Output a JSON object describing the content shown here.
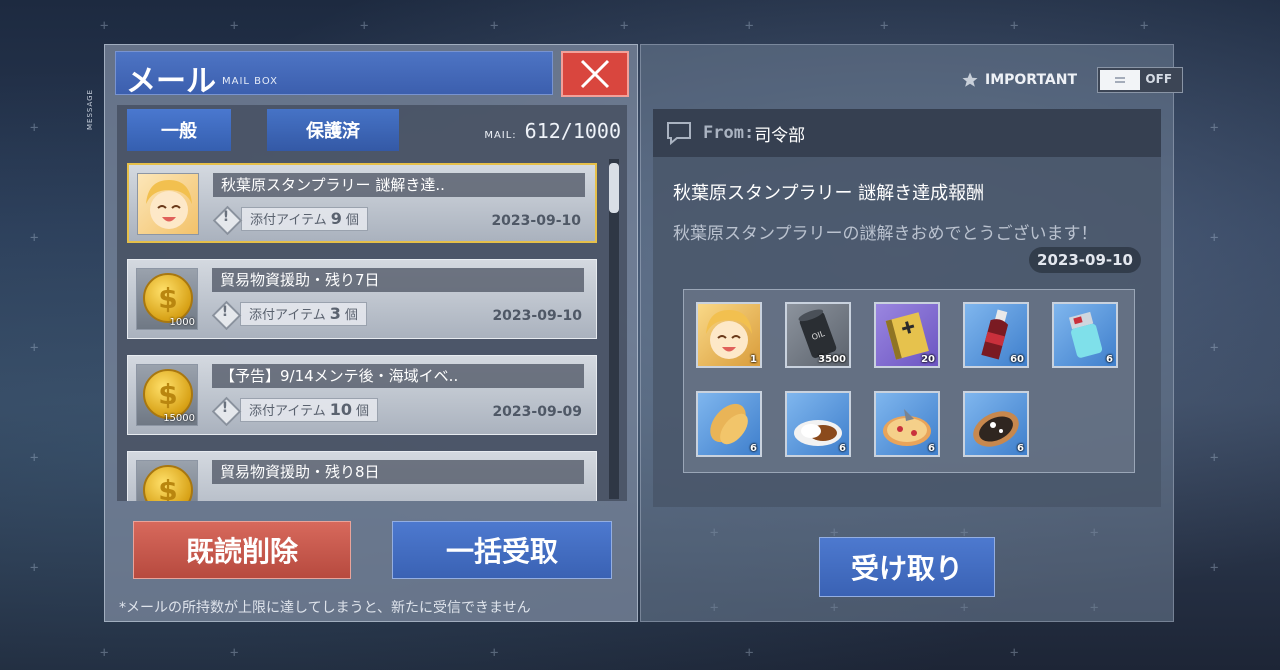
{
  "side_tag": "MESSAGE",
  "mailbox": {
    "title": "メール",
    "subtitle": "MAIL BOX",
    "tabs": [
      {
        "label": "一般"
      },
      {
        "label": "保護済"
      }
    ],
    "mail_count_label": "MAIL:",
    "mail_count": "612/1000",
    "mails": [
      {
        "title": "秋葉原スタンプラリー 謎解き達..",
        "attach_label": "添付アイテム",
        "attach_count": "9",
        "unit": "個",
        "date": "2023-09-10",
        "thumb": "character-icon",
        "thumb_value": "",
        "selected": true
      },
      {
        "title": "貿易物資援助・残り7日",
        "attach_label": "添付アイテム",
        "attach_count": "3",
        "unit": "個",
        "date": "2023-09-10",
        "thumb": "coin-icon",
        "thumb_value": "1000",
        "selected": false
      },
      {
        "title": "【予告】9/14メンテ後・海域イベ..",
        "attach_label": "添付アイテム",
        "attach_count": "10",
        "unit": "個",
        "date": "2023-09-09",
        "thumb": "coin-icon",
        "thumb_value": "15000",
        "selected": false
      },
      {
        "title": "貿易物資援助・残り8日",
        "attach_label": "",
        "attach_count": "",
        "unit": "",
        "date": "",
        "thumb": "coin-icon",
        "thumb_value": "",
        "selected": false
      }
    ],
    "delete_read_label": "既読削除",
    "claim_all_label": "一括受取",
    "note": "*メールの所持数が上限に達してしまうと、新たに受信できません"
  },
  "detail": {
    "important_label": "IMPORTANT",
    "toggle_state": "OFF",
    "from_label": "From:",
    "from_value": "司令部",
    "title": "秋葉原スタンプラリー 謎解き達成報酬",
    "body": "秋葉原スタンプラリーの謎解きおめでとうございます！",
    "date": "2023-09-10",
    "items": [
      {
        "icon": "character-icon",
        "count": "1",
        "bg": "gold"
      },
      {
        "icon": "oil-barrel-icon",
        "count": "3500",
        "bg": "grey"
      },
      {
        "icon": "manual-book-icon",
        "count": "20",
        "bg": "purple"
      },
      {
        "icon": "cola-bottle-icon",
        "count": "60",
        "bg": "blue"
      },
      {
        "icon": "canister-icon",
        "count": "6",
        "bg": "blue"
      },
      {
        "icon": "fried-food-icon",
        "count": "6",
        "bg": "blue"
      },
      {
        "icon": "curry-plate-icon",
        "count": "6",
        "bg": "blue"
      },
      {
        "icon": "pizza-icon",
        "count": "6",
        "bg": "blue"
      },
      {
        "icon": "dish-icon",
        "count": "6",
        "bg": "blue"
      }
    ],
    "claim_label": "受け取り"
  }
}
